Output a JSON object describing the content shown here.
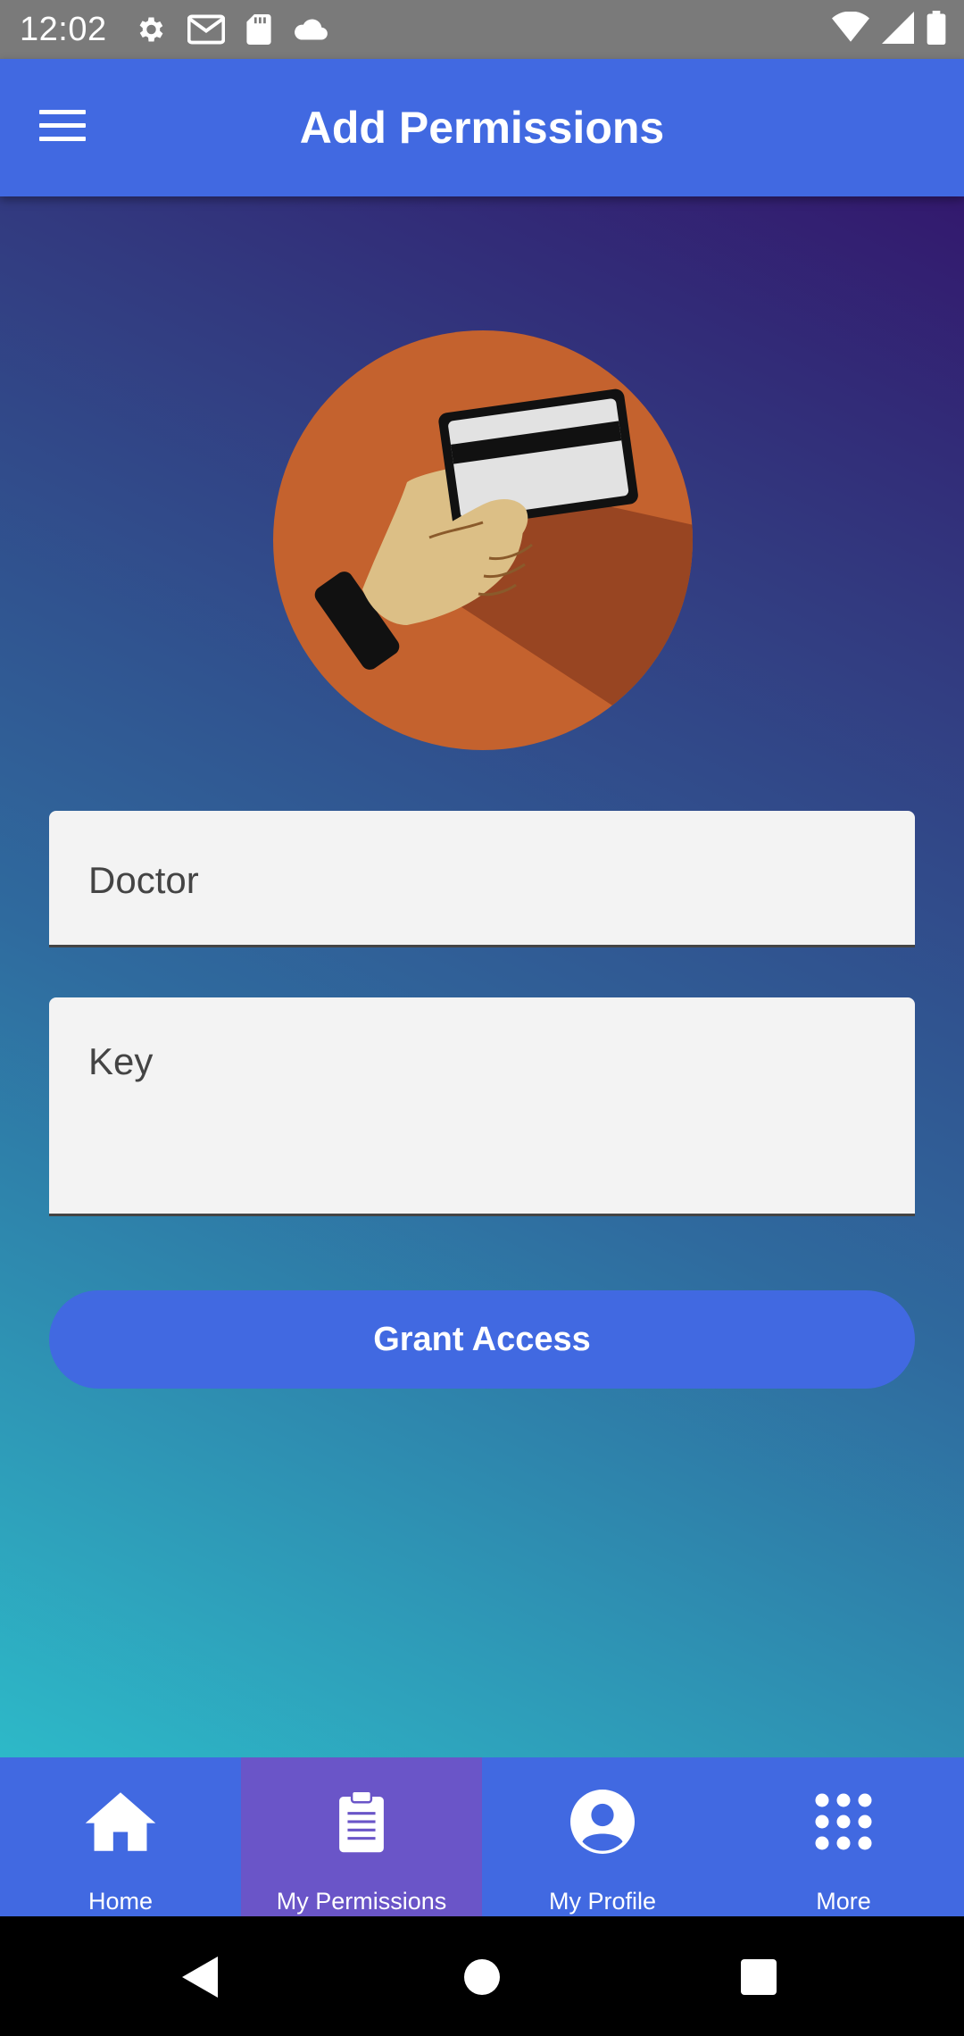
{
  "status_bar": {
    "time": "12:02",
    "left_icons": [
      "settings-icon",
      "gmail-icon",
      "sd-card-icon",
      "cloud-icon"
    ],
    "right_icons": [
      "wifi-icon",
      "signal-icon",
      "battery-icon"
    ]
  },
  "app_bar": {
    "title": "Add Permissions",
    "menu_icon": "hamburger-menu-icon"
  },
  "hero": {
    "icon": "hand-holding-card-illustration",
    "circle_color": "#c4622e"
  },
  "form": {
    "doctor_placeholder": "Doctor",
    "key_placeholder": "Key",
    "grant_label": "Grant Access"
  },
  "bottom_nav": {
    "items": [
      {
        "label": "Home",
        "icon": "home-icon",
        "active": false
      },
      {
        "label": "My Permissions",
        "icon": "clipboard-icon",
        "active": true
      },
      {
        "label": "My Profile",
        "icon": "profile-icon",
        "active": false
      },
      {
        "label": "More",
        "icon": "grid-icon",
        "active": false
      }
    ]
  },
  "colors": {
    "primary": "#4169e1",
    "active_tab": "#6a55c8",
    "gradient_top": "#33196e",
    "gradient_bottom": "#2db9c8"
  },
  "system_nav": [
    "back-icon",
    "home-circle-icon",
    "recents-icon"
  ]
}
